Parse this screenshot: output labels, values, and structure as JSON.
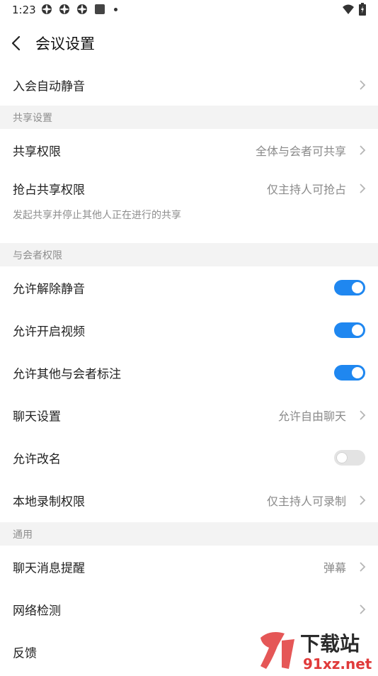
{
  "status_bar": {
    "time": "1:23"
  },
  "header": {
    "title": "会议设置"
  },
  "rows": {
    "auto_mute": {
      "label": "入会自动静音"
    },
    "share_permission": {
      "label": "共享权限",
      "value": "全体与会者可共享"
    },
    "grab_share": {
      "label": "抢占共享权限",
      "value": "仅主持人可抢占",
      "note": "发起共享并停止其他人正在进行的共享"
    },
    "allow_unmute": {
      "label": "允许解除静音",
      "enabled": true
    },
    "allow_video": {
      "label": "允许开启视频",
      "enabled": true
    },
    "allow_annotate": {
      "label": "允许其他与会者标注",
      "enabled": true
    },
    "chat_settings": {
      "label": "聊天设置",
      "value": "允许自由聊天"
    },
    "allow_rename": {
      "label": "允许改名",
      "enabled": false
    },
    "local_record": {
      "label": "本地录制权限",
      "value": "仅主持人可录制"
    },
    "chat_reminder": {
      "label": "聊天消息提醒",
      "value": "弹幕"
    },
    "network_check": {
      "label": "网络检测"
    },
    "feedback": {
      "label": "反馈"
    }
  },
  "sections": {
    "share": "共享设置",
    "participant": "与会者权限",
    "general": "通用"
  },
  "watermark": {
    "text": "下载站",
    "url_text": "91xz.net"
  },
  "colors": {
    "accent": "#1f87f0",
    "section_bg": "#f3f3f3",
    "secondary_text": "#8a8a8a",
    "watermark_red": "#e03a3a"
  }
}
